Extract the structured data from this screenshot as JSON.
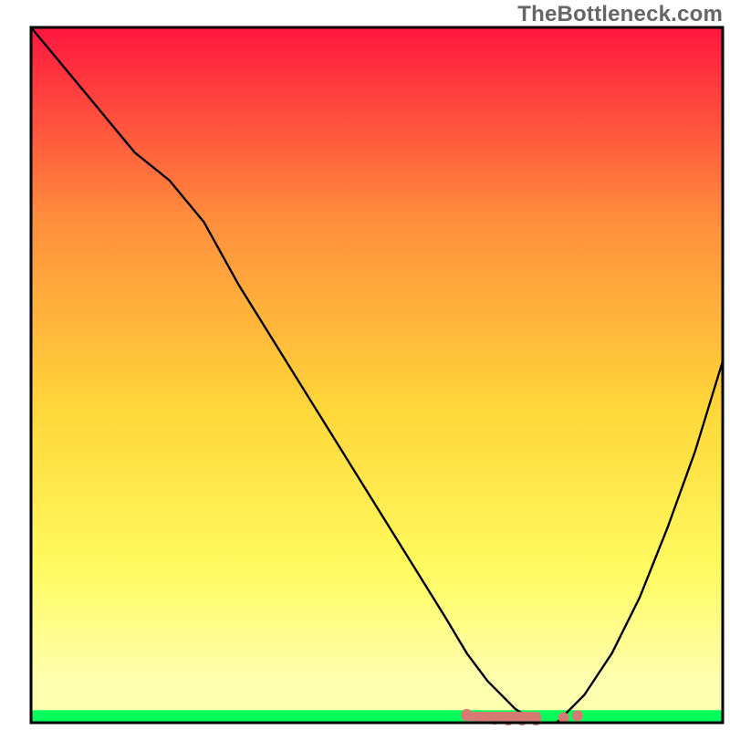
{
  "watermark": "TheBottleneck.com",
  "chart_data": {
    "type": "line",
    "title": "",
    "xlabel": "",
    "ylabel": "",
    "xlim": [
      0,
      100
    ],
    "ylim": [
      0,
      100
    ],
    "background_gradient": {
      "top": "#ff163f",
      "mid_upper": "#ff8f3c",
      "mid": "#ffd73a",
      "mid_lower": "#fffb60",
      "lower": "#ffffb0",
      "bottom_band": "#00ff5a"
    },
    "series": [
      {
        "name": "bottleneck-curve",
        "description": "V-shaped curve descending from top-left to a flat minimum around x≈73 then rising toward top-right",
        "x": [
          0,
          5,
          10,
          15,
          20,
          25,
          30,
          35,
          40,
          45,
          50,
          55,
          60,
          63,
          66,
          70,
          73,
          76,
          80,
          84,
          88,
          92,
          96,
          100
        ],
        "y": [
          100,
          94,
          88,
          82,
          78,
          72,
          63,
          55,
          47,
          39,
          31,
          23,
          15,
          10,
          6,
          2,
          0,
          0,
          4,
          10,
          18,
          28,
          39,
          52
        ]
      }
    ],
    "markers": {
      "name": "minimum-band-markers",
      "color": "#d77a74",
      "points": [
        {
          "x": 63,
          "y": 1.2
        },
        {
          "x": 65,
          "y": 0.6
        },
        {
          "x": 67,
          "y": 0.5
        },
        {
          "x": 69,
          "y": 0.4
        },
        {
          "x": 71,
          "y": 0.4
        },
        {
          "x": 73,
          "y": 0.4
        },
        {
          "x": 77,
          "y": 0.7
        },
        {
          "x": 79,
          "y": 1.0
        }
      ]
    },
    "axes_visible": false,
    "grid": false
  }
}
